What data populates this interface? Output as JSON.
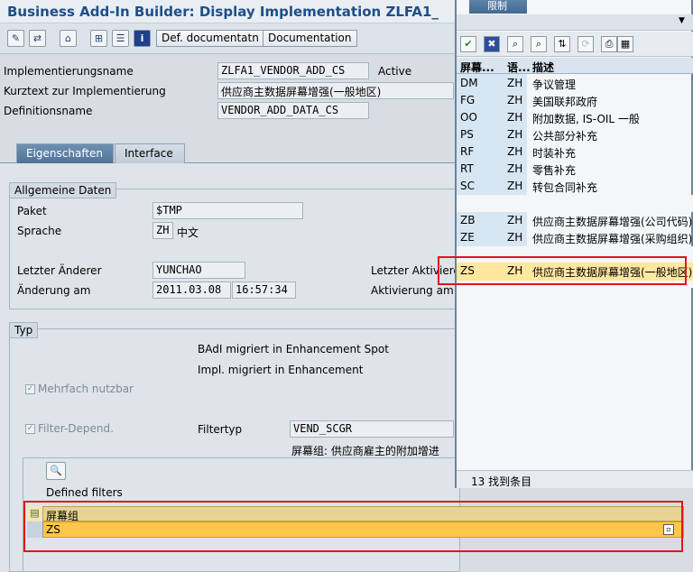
{
  "window": {
    "title": "Business Add-In Builder: Display Implementation ZLFA1_"
  },
  "toolbar": {
    "def_doc_label": "Def. documentatn",
    "documentation_label": "Documentation",
    "icons": [
      "pencil-icon",
      "display-change-icon",
      "other-object-icon",
      "hierarchy-icon",
      "tree-icon",
      "info-icon"
    ]
  },
  "header": {
    "impl_name_label": "Implementierungsname",
    "impl_name_value": "ZLFA1_VENDOR_ADD_CS",
    "status": "Active",
    "short_text_label": "Kurztext zur Implementierung",
    "short_text_value": "供应商主数据屏幕增强(一般地区)",
    "def_name_label": "Definitionsname",
    "def_name_value": "VENDOR_ADD_DATA_CS"
  },
  "tabs": [
    {
      "label": "Eigenschaften",
      "active": true
    },
    {
      "label": "Interface",
      "active": false
    }
  ],
  "general": {
    "title": "Allgemeine Daten",
    "paket_label": "Paket",
    "paket_value": "$TMP",
    "sprache_label": "Sprache",
    "sprache_code": "ZH",
    "sprache_name": "中文",
    "changer_label": "Letzter Änderer",
    "changer_value": "YUNCHAO",
    "changed_on_label": "Änderung am",
    "changed_date": "2011.03.08",
    "changed_time": "16:57:34",
    "activator_label": "Letzter Aktivierer",
    "activation_label": "Aktivierung am"
  },
  "typ": {
    "title": "Typ",
    "badi_migrated": "BAdI migriert in Enhancement Spot",
    "impl_migrated": "Impl. migriert in Enhancement",
    "multiple_use": "Mehrfach nutzbar",
    "filter_dep": "Filter-Depend.",
    "filtertyp_label": "Filtertyp",
    "filtertyp_value": "VEND_SCGR",
    "filtertyp_desc": "屏幕组: 供应商雇主的附加增进",
    "defined_filters_label": "Defined filters",
    "filter_column": "屏幕组",
    "filter_value": "ZS"
  },
  "popup": {
    "tab_label": "限制",
    "columns": [
      "屏幕...",
      "语...",
      "描述"
    ],
    "rows": [
      {
        "code": "DM",
        "lang": "ZH",
        "desc": "争议管理"
      },
      {
        "code": "FG",
        "lang": "ZH",
        "desc": "美国联邦政府"
      },
      {
        "code": "OO",
        "lang": "ZH",
        "desc": "附加数据, IS-OIL 一般"
      },
      {
        "code": "PS",
        "lang": "ZH",
        "desc": "公共部分补充"
      },
      {
        "code": "RF",
        "lang": "ZH",
        "desc": "时装补充"
      },
      {
        "code": "RT",
        "lang": "ZH",
        "desc": "零售补充"
      },
      {
        "code": "SC",
        "lang": "ZH",
        "desc": "转包合同补充"
      },
      {
        "code": "ZB",
        "lang": "ZH",
        "desc": "供应商主数据屏幕增强(公司代码)"
      },
      {
        "code": "ZE",
        "lang": "ZH",
        "desc": "供应商主数据屏幕增强(采购组织)"
      },
      {
        "code": "ZS",
        "lang": "ZH",
        "desc": "供应商主数据屏幕增强(一般地区)"
      }
    ],
    "footer": "13 找到条目"
  }
}
